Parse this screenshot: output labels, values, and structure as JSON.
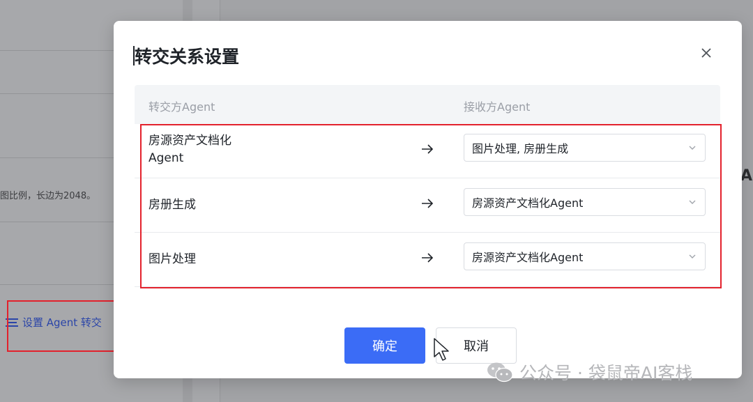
{
  "background": {
    "text_line": "图比例，长边为2048。",
    "link_label": "设置 Agent 转交",
    "right_fragment": "Ag"
  },
  "modal": {
    "title": "转交关系设置",
    "header": {
      "source_col": "转交方Agent",
      "target_col": "接收方Agent"
    },
    "rows": [
      {
        "source": "房源资产文档化\nAgent",
        "target": "图片处理, 房册生成"
      },
      {
        "source": "房册生成",
        "target": "房源资产文档化Agent"
      },
      {
        "source": "图片处理",
        "target": "房源资产文档化Agent"
      }
    ],
    "buttons": {
      "confirm": "确定",
      "cancel": "取消"
    }
  },
  "watermark": {
    "text": "公众号 · 袋鼠帝AI客栈"
  },
  "colors": {
    "primary": "#3b6cf6",
    "highlight_red": "#e3212c",
    "link_blue": "#2b45a8"
  }
}
